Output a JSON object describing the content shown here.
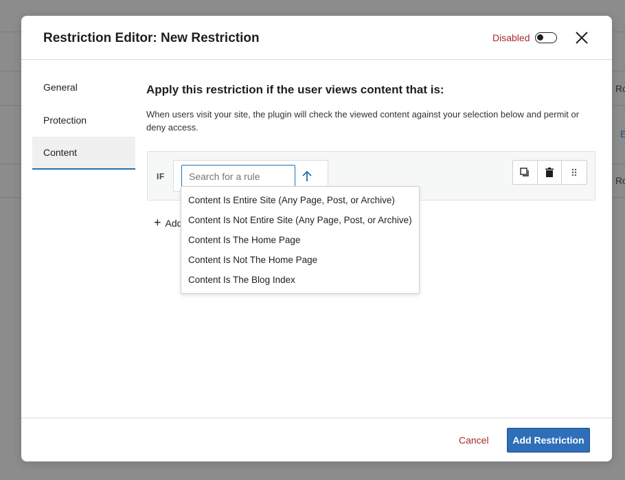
{
  "background": {
    "row_texts": [
      "Ro",
      "E",
      "Ro"
    ]
  },
  "modal": {
    "title": "Restriction Editor: New Restriction",
    "status_label": "Disabled",
    "status_enabled": false
  },
  "sidebar": {
    "items": [
      {
        "label": "General",
        "active": false
      },
      {
        "label": "Protection",
        "active": false
      },
      {
        "label": "Content",
        "active": true
      }
    ]
  },
  "content": {
    "heading": "Apply this restriction if the user views content that is:",
    "description": "When users visit your site, the plugin will check the viewed content against your selection below and permit or deny access.",
    "rule": {
      "if_label": "IF",
      "search_placeholder": "Search for a rule",
      "search_value": ""
    },
    "add_rule_label": "Add",
    "dropdown_options": [
      "Content Is Entire Site (Any Page, Post, or Archive)",
      "Content Is Not Entire Site (Any Page, Post, or Archive)",
      "Content Is The Home Page",
      "Content Is Not The Home Page",
      "Content Is The Blog Index"
    ]
  },
  "footer": {
    "cancel_label": "Cancel",
    "submit_label": "Add Restriction"
  },
  "colors": {
    "accent": "#2271b1",
    "primary_button": "#2f6fb9",
    "danger": "#a82a2a"
  }
}
